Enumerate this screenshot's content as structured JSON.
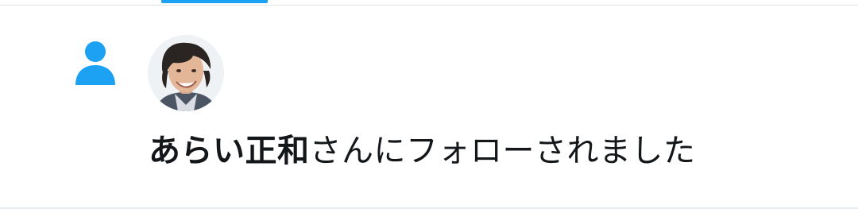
{
  "colors": {
    "accent": "#1da1f2",
    "text": "#14171a",
    "divider": "#e6ecf0"
  },
  "tabs": {
    "active_indicator": "tab-indicator"
  },
  "notification": {
    "type": "follow",
    "icon": "person-icon",
    "avatar": "user-avatar-photo",
    "user_name": "あらい正和",
    "action_text": "さんにフォローされました"
  }
}
